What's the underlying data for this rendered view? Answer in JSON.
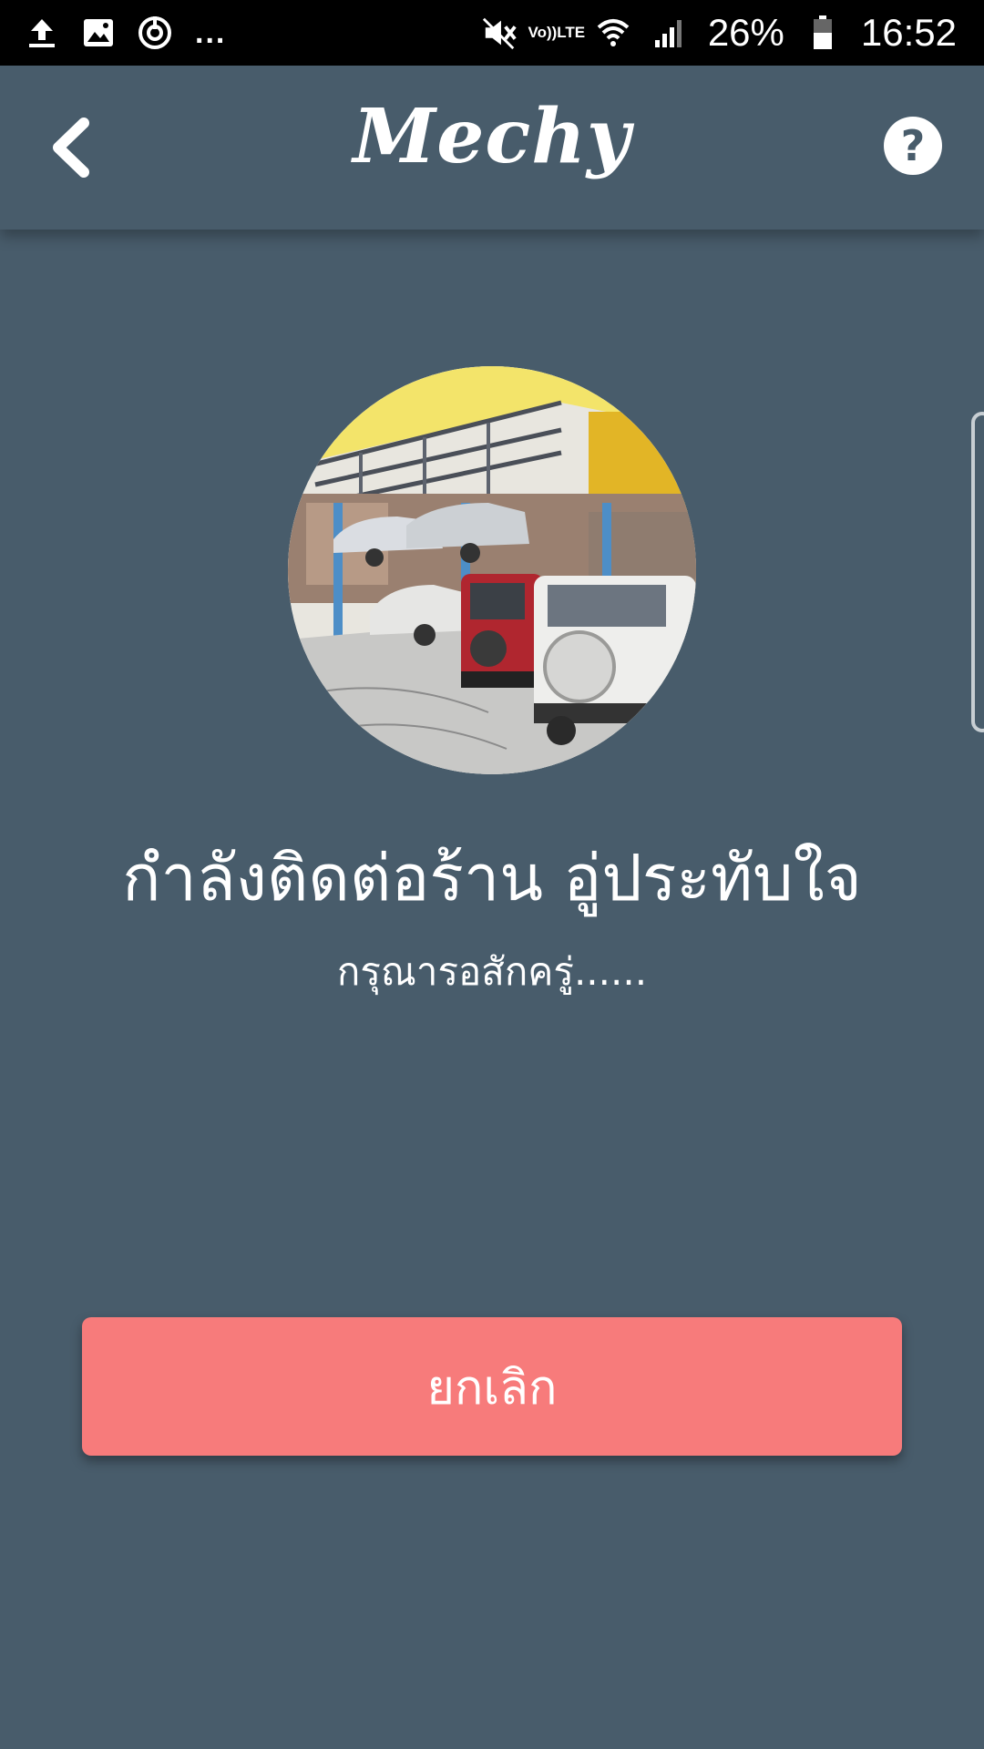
{
  "status_bar": {
    "icons_left": [
      "upload-icon",
      "image-icon",
      "sync-icon"
    ],
    "more": "...",
    "icons_right": [
      "mute-icon",
      "volte-icon",
      "wifi-icon",
      "signal-icon"
    ],
    "volte_top": "Vo))",
    "volte_bottom": "LTE",
    "battery": "26%",
    "time": "16:52"
  },
  "header": {
    "title": "Mechy",
    "back_icon": "chevron-left-icon",
    "help_icon": "help-icon",
    "help_symbol": "?"
  },
  "main": {
    "title": "กำลังติดต่อร้าน อู่ประทับใจ",
    "subtitle": "กรุณารอสักครู่......",
    "cancel_label": "ยกเลิก"
  },
  "colors": {
    "background": "#485c6b",
    "status_bar": "#000000",
    "cancel_button": "#f77b7b",
    "text": "#ffffff"
  }
}
